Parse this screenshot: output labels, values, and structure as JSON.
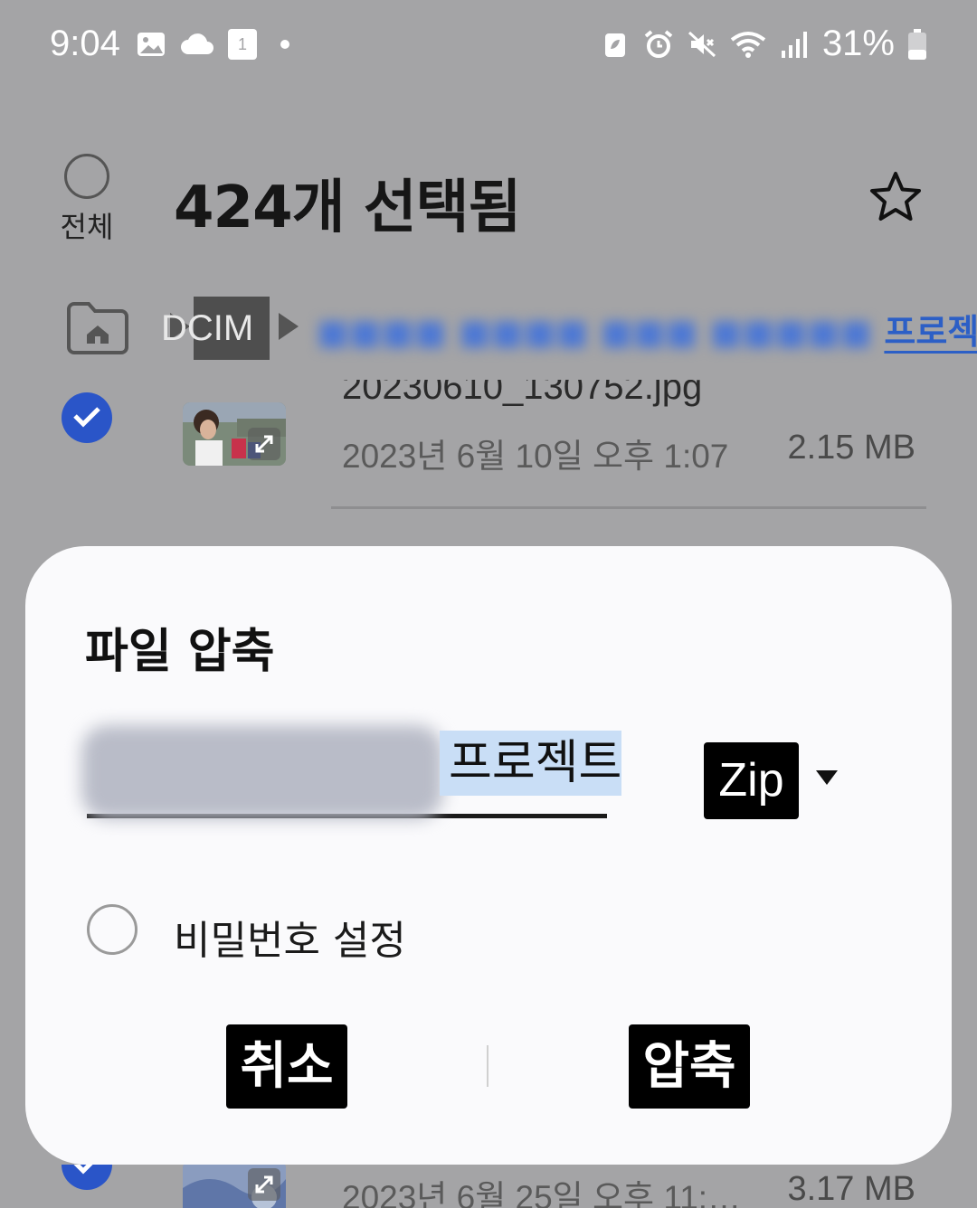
{
  "status_bar": {
    "time": "9:04",
    "battery_percent": "31%",
    "left_icons": [
      "gallery-icon",
      "cloud-icon",
      "calendar-icon",
      "dot-icon"
    ],
    "calendar_day": "1",
    "right_icons": [
      "battery-saver-icon",
      "alarm-icon",
      "mute-icon",
      "wifi-icon",
      "signal-icon",
      "battery-icon"
    ]
  },
  "header": {
    "select_all_label": "전체",
    "title": "424개 선택됨",
    "star_icon": "star-icon"
  },
  "breadcrumb": {
    "home_icon": "home-folder-icon",
    "dcim_label": "DCIM",
    "current_folder_visible": "프로젝트"
  },
  "list": {
    "items": [
      {
        "filename": "20230610_130752.jpg",
        "date": "2023년 6월 10일 오후 1:07",
        "size": "2.15 MB",
        "checked": true
      },
      {
        "filename": "",
        "date": "2023년 6월 25일 오후 11:…",
        "size": "3.17 MB",
        "checked": true
      }
    ]
  },
  "dialog": {
    "title": "파일 압축",
    "filename_visible": "프로젝트",
    "format_label": "Zip",
    "password_label": "비밀번호 설정",
    "cancel_label": "취소",
    "compress_label": "압축"
  },
  "colors": {
    "overlay_bg": "#a4a4a6",
    "dialog_bg": "#fafafc",
    "accent_blue": "#2a55c8",
    "selection_highlight": "#c9def6"
  }
}
